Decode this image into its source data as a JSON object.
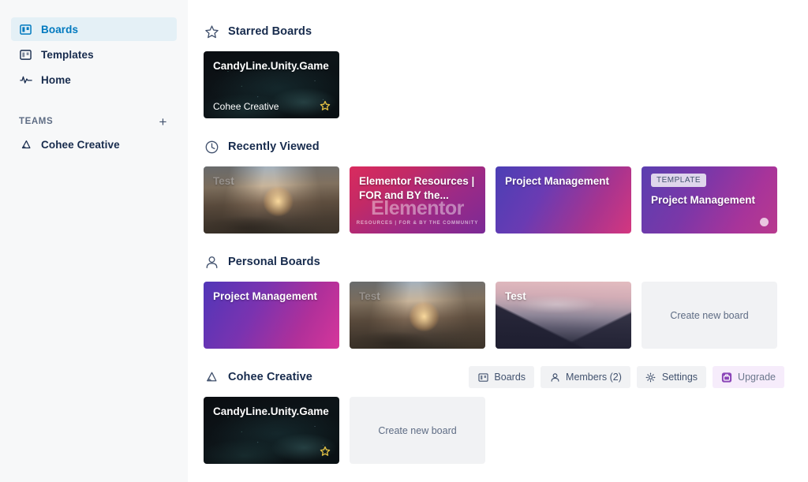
{
  "sidebar": {
    "items": [
      {
        "label": "Boards",
        "icon": "boards-icon",
        "active": true
      },
      {
        "label": "Templates",
        "icon": "templates-icon",
        "active": false
      },
      {
        "label": "Home",
        "icon": "home-activity-icon",
        "active": false
      }
    ],
    "teams_label": "TEAMS",
    "add_team_label": "+",
    "teams": [
      {
        "label": "Cohee Creative",
        "icon": "team-icon"
      }
    ]
  },
  "sections": {
    "starred": {
      "title": "Starred Boards",
      "icon": "star-icon",
      "boards": [
        {
          "title": "CandyLine.Unity.Game",
          "subtitle": "Cohee Creative",
          "starred": true,
          "style": "bg-space"
        }
      ]
    },
    "recent": {
      "title": "Recently Viewed",
      "icon": "clock-icon",
      "boards": [
        {
          "title": "Test",
          "style": "bg-desert"
        },
        {
          "title": "Elementor Resources | FOR and BY the...",
          "style": "bg-elementor",
          "watermark": "Elementor",
          "watermark_sub": "RESOURCES | FOR & BY THE COMMUNITY"
        },
        {
          "title": "Project Management",
          "style": "bg-grad-pm"
        },
        {
          "title": "Project Management",
          "style": "bg-grad-pm2",
          "badge": "TEMPLATE",
          "dot": true
        }
      ]
    },
    "personal": {
      "title": "Personal Boards",
      "icon": "person-icon",
      "boards": [
        {
          "title": "Project Management",
          "style": "bg-grad-personal"
        },
        {
          "title": "Test",
          "style": "bg-desert"
        },
        {
          "title": "Test",
          "style": "bg-mountain"
        }
      ],
      "create_label": "Create new board"
    },
    "team": {
      "title": "Cohee Creative",
      "icon": "team-icon",
      "actions": [
        {
          "label": "Boards",
          "icon": "boards-icon",
          "style": "default"
        },
        {
          "label": "Members (2)",
          "icon": "person-icon",
          "style": "default"
        },
        {
          "label": "Settings",
          "icon": "gear-icon",
          "style": "default"
        },
        {
          "label": "Upgrade",
          "icon": "briefcase-icon",
          "style": "upgrade"
        }
      ],
      "boards": [
        {
          "title": "CandyLine.Unity.Game",
          "starred": true,
          "style": "bg-space"
        }
      ],
      "create_label": "Create new board"
    }
  },
  "colors": {
    "accent": "#0079bf",
    "active_bg": "#e4f0f6",
    "sidebar_bg": "#f7f8f9",
    "tile_placeholder": "#f1f2f4",
    "upgrade_bg": "#f6ecfb",
    "star": "#e2c044"
  }
}
